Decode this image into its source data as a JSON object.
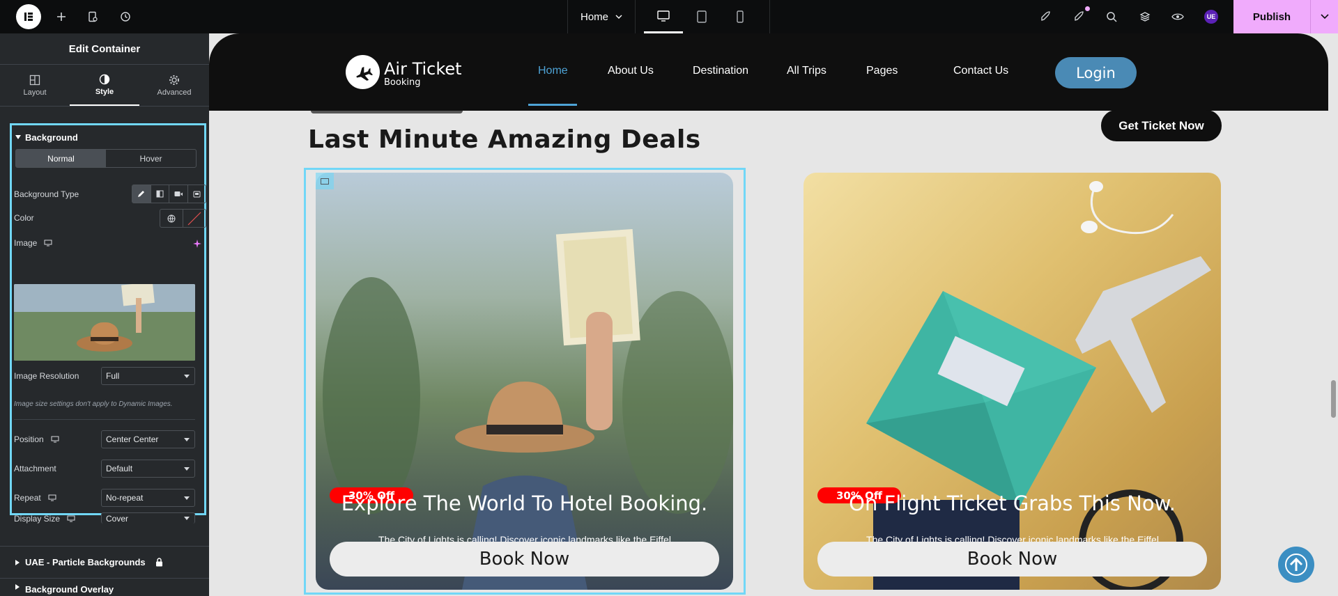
{
  "topbar": {
    "page_name": "Home",
    "avatar_initials": "UE",
    "publish_label": "Publish"
  },
  "panel": {
    "title": "Edit Container",
    "tabs": [
      {
        "label": "Layout",
        "icon": "layout-icon"
      },
      {
        "label": "Style",
        "icon": "contrast-icon"
      },
      {
        "label": "Advanced",
        "icon": "gear-icon"
      }
    ],
    "background": {
      "heading": "Background",
      "state_tabs": [
        "Normal",
        "Hover"
      ],
      "background_type_label": "Background Type",
      "color_label": "Color",
      "image_label": "Image",
      "image_resolution_label": "Image Resolution",
      "image_resolution_value": "Full",
      "note": "Image size settings don't apply to Dynamic Images.",
      "position_label": "Position",
      "position_value": "Center Center",
      "attachment_label": "Attachment",
      "attachment_value": "Default",
      "repeat_label": "Repeat",
      "repeat_value": "No-repeat",
      "display_size_label": "Display Size",
      "display_size_value": "Cover"
    },
    "sections_below": [
      "UAE - Particle Backgrounds",
      "Background Overlay"
    ]
  },
  "site": {
    "brand_title": "Air Ticket",
    "brand_sub": "Booking",
    "nav": [
      "Home",
      "About Us",
      "Destination",
      "All Trips",
      "Pages",
      "Contact Us"
    ],
    "login_label": "Login",
    "section_title": "Last Minute Amazing Deals",
    "get_ticket_label": "Get Ticket Now",
    "cards": [
      {
        "badge": "30% Off",
        "title": "Explore The World To Hotel Booking.",
        "desc": "The City of Lights is calling! Discover iconic landmarks like the Eiffel Tower, world-class museums, and romantic streets.",
        "button": "Book Now"
      },
      {
        "badge": "30% Off",
        "title": "On Flight Ticket Grabs This Now.",
        "desc": "The City of Lights is calling! Discover iconic landmarks like the Eiffel Tower, world-class museums, and romantic streets.",
        "button": "Book Now"
      }
    ]
  },
  "colors": {
    "accent_selection": "#71d7f7",
    "publish_bg": "#f0abfc",
    "nav_active": "#4ea3d6",
    "badge_red": "#ff0000"
  }
}
